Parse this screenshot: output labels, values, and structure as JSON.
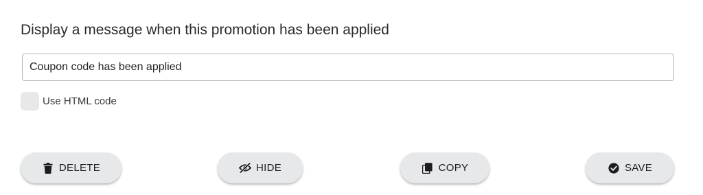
{
  "message_section": {
    "heading": "Display a message when this promotion has been applied",
    "message_value": "Coupon code has been applied",
    "html_checkbox_label": "Use HTML code",
    "html_checkbox_checked": false
  },
  "actions": {
    "delete_label": "DELETE",
    "hide_label": "HIDE",
    "copy_label": "COPY",
    "save_label": "SAVE",
    "delete_icon": "trash-icon",
    "hide_icon": "eye-slash-icon",
    "copy_icon": "copy-icon",
    "save_icon": "check-circle-icon"
  },
  "colors": {
    "button_background": "#e7e8ea",
    "checkbox_background": "#e8e8e8",
    "field_border": "#b5b5b5",
    "text": "#2b2b2b"
  }
}
